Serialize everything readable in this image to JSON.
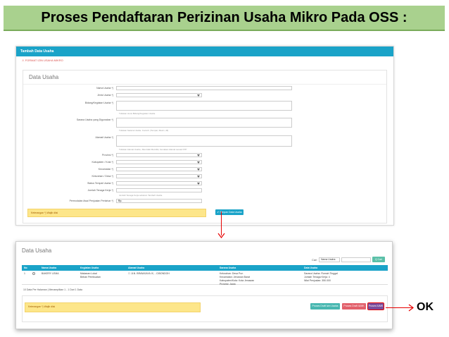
{
  "slide_title": "Proses Pendaftaran Perizinan Usaha Mikro Pada OSS :",
  "form_screen": {
    "header": "Tambah Data Usaha",
    "warning": "⚠ FORMAT IZIN USAHA MIKRO",
    "panel_title": "Data Usaha",
    "fields": [
      {
        "label": "Nama Usaha *)"
      },
      {
        "label": "Jenis Usaha *)"
      },
      {
        "label": "Bidang/Kegiatan Usaha *)",
        "hint": "Tuliskan Jenis Bidang/Kegiatan Usaha"
      },
      {
        "label": "Sarana Usaha yang Digunakan *)",
        "hint": "Tuliskan Sarana Usaha. Contoh: (Tempat, Mesin, dll)"
      },
      {
        "label": "Alamat Usaha *)",
        "hint": "Tuliskan Alamat Usaha, Jika tidak Memiliki, Gunakan Alamat sesuai KTP"
      },
      {
        "label": "Provinsi *)"
      },
      {
        "label": "Kabupaten / Kota *)"
      },
      {
        "label": "Kecamatan *)"
      },
      {
        "label": "Kelurahan / Desa *)"
      },
      {
        "label": "Status Tempat Usaha *)"
      },
      {
        "label": "Jumlah Tenaga Kerja *)",
        "hint": "Jumlah Tenaga Kerja sebelum Tambah Usaha"
      },
      {
        "label": "Permodalan Awal Penjualan Pertahun *)",
        "prefix": "Rp."
      }
    ],
    "note": "Keterangan *) Wajib diisi",
    "save_button": "✔ Simpan Data Usaha"
  },
  "list_screen": {
    "panel_title": "Data Usaha",
    "search_label": "Cari",
    "search_select": "Nama Usaha",
    "search_button": "Q Cari",
    "columns": [
      "No",
      "Nama Usaha",
      "Kegiatan Usaha",
      "Alamat Usaha",
      "Sarana Usaha",
      "Data Usaha"
    ],
    "row": {
      "no": "1",
      "nama": "BAKERY LEMA",
      "kegiatan": "Makanan Lokal\nBeban Pembuatan",
      "alamat": "☐ JLN. BRAWIJAYA IX, - CIBONDOH",
      "sarana": "Kelurahan: Desa Pun\nKecamatan: Jenawan Barat\nKabupaten/Kota: Kota Jenawan\nProvinsi: Jawa",
      "data": "Sarana Usaha: Rumah Tinggal\nJumlah Tenaga Kerja: 4\nNilai Penjualan: 350.000"
    },
    "pager": "10 Data Per Halaman | Menampilkan 1 - 1 Dari 1 Data",
    "note": "Keterangan *) Wajib diisi",
    "buttons": [
      "Proses Draft Izin Usaha",
      "Proses Draft IUMK",
      "Proses IUMK"
    ]
  },
  "callout": "OK",
  "colors": {
    "accent": "#1aa3c8",
    "title_bg": "#a9d18e",
    "arrow": "#e60000"
  }
}
